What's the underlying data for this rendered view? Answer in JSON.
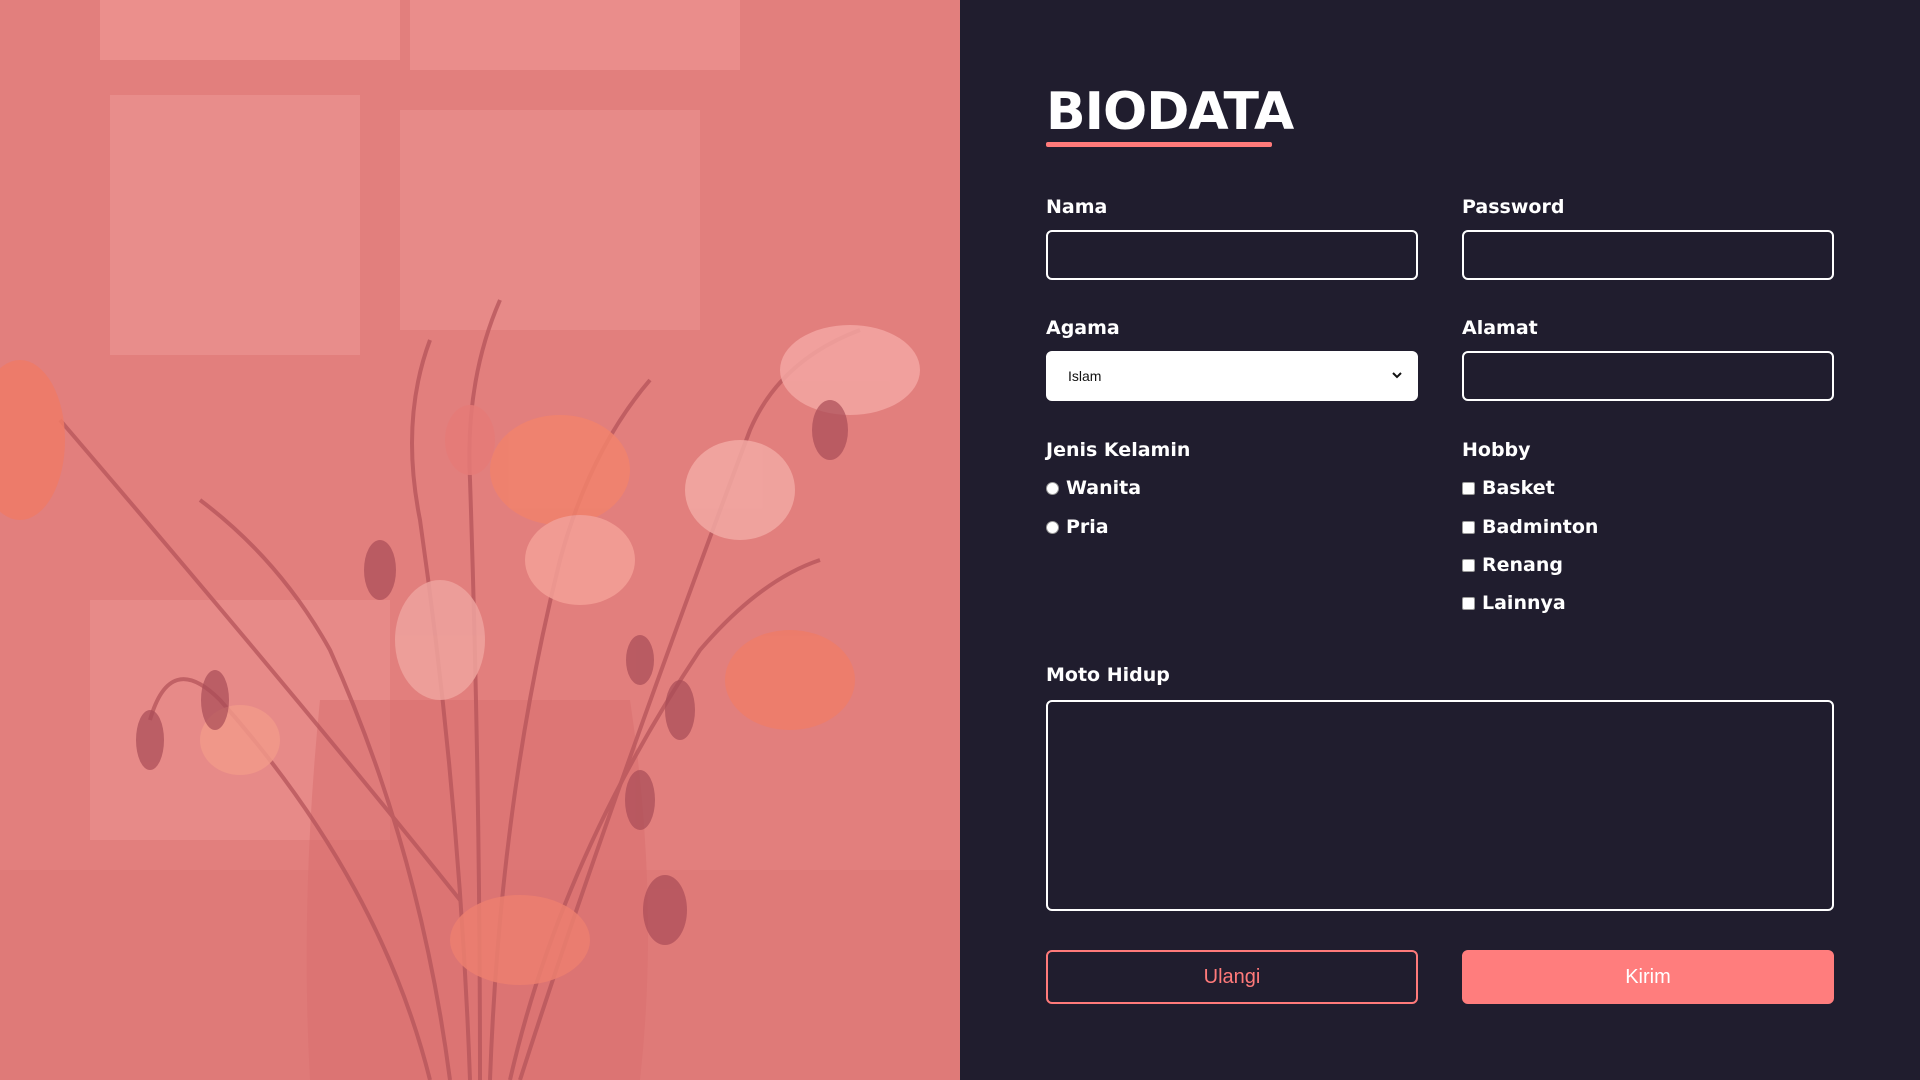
{
  "form": {
    "title": "BIODATA",
    "nama_label": "Nama",
    "nama_value": "",
    "password_label": "Password",
    "password_value": "",
    "agama_label": "Agama",
    "agama_selected": "Islam",
    "alamat_label": "Alamat",
    "alamat_value": "",
    "gender_label": "Jenis Kelamin",
    "gender_options": [
      "Wanita",
      "Pria"
    ],
    "hobby_label": "Hobby",
    "hobby_options": [
      "Basket",
      "Badminton",
      "Renang",
      "Lainnya"
    ],
    "moto_label": "Moto Hidup",
    "moto_value": "",
    "reset_label": "Ulangi",
    "submit_label": "Kirim"
  },
  "colors": {
    "background": "#201d2e",
    "accent": "#ff7a7a",
    "photo_tint": "#e27f7d"
  },
  "icons": {
    "select_caret": "chevron-down-icon"
  }
}
